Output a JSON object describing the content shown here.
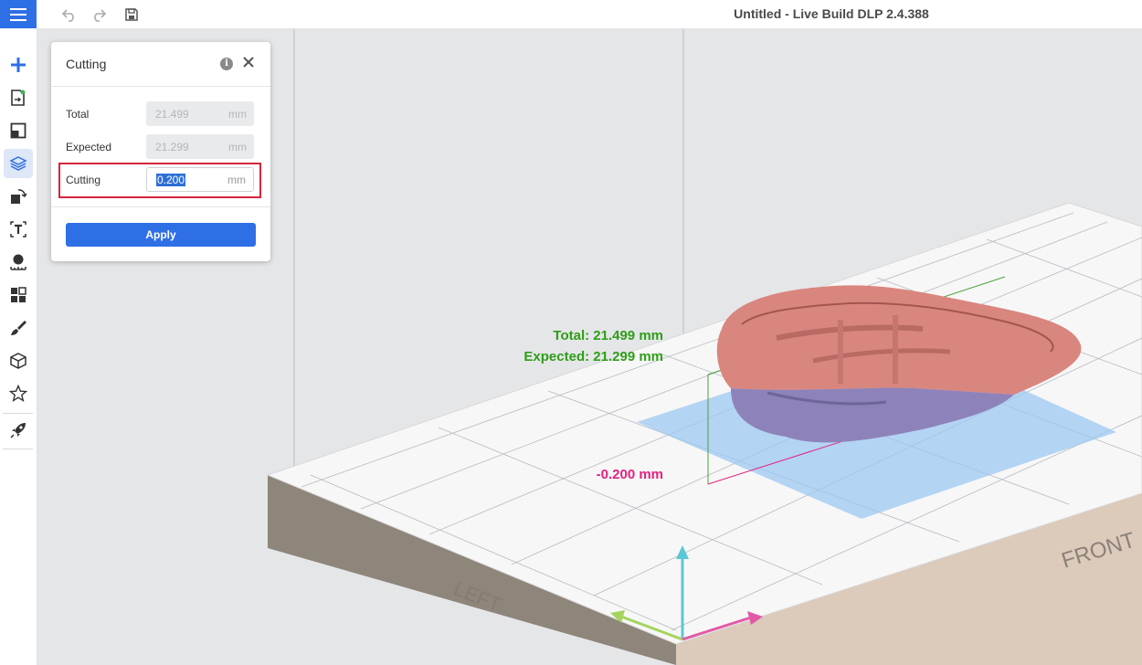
{
  "app": {
    "title": "Untitled - Live Build DLP 2.4.388"
  },
  "toolbar": {
    "icons": [
      "menu-icon",
      "undo-icon",
      "redo-icon",
      "save-icon"
    ]
  },
  "sidebar": {
    "items": [
      {
        "icon": "add-icon"
      },
      {
        "icon": "import-file-icon"
      },
      {
        "icon": "layout-icon"
      },
      {
        "icon": "cut-layers-icon",
        "active": true
      },
      {
        "icon": "transform-icon"
      },
      {
        "icon": "text-icon"
      },
      {
        "icon": "measure-icon"
      },
      {
        "icon": "grid-arrange-icon"
      },
      {
        "icon": "brush-icon"
      },
      {
        "icon": "support-box-icon"
      },
      {
        "icon": "star-icon"
      },
      {
        "icon": "rocket-icon"
      }
    ]
  },
  "cutting_panel": {
    "title": "Cutting",
    "rows": [
      {
        "label": "Total",
        "value": "21.499",
        "unit": "mm"
      },
      {
        "label": "Expected",
        "value": "21.299",
        "unit": "mm"
      },
      {
        "label": "Cutting",
        "value": "0.200",
        "unit": "mm"
      }
    ],
    "apply_label": "Apply"
  },
  "viewport": {
    "total_label": "Total: 21.499 mm",
    "expected_label": "Expected: 21.299 mm",
    "cut_label": "-0.200 mm",
    "face_front": "FRONT",
    "face_left": "LEFT",
    "colors": {
      "green_label": "#2e9e18",
      "pink_label": "#e2237f",
      "cut_plane": "#9cc8f2",
      "model": "#d9867f"
    }
  }
}
